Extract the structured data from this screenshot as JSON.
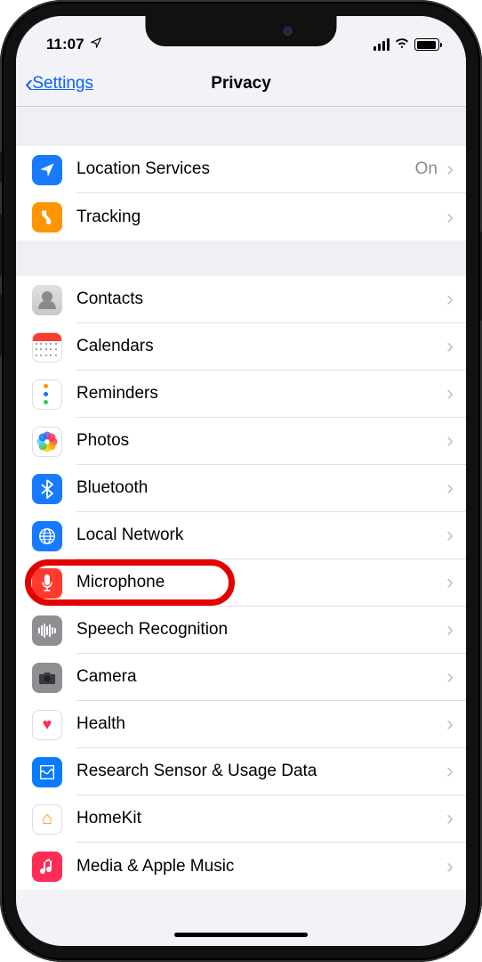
{
  "status": {
    "time": "11:07"
  },
  "nav": {
    "back": "Settings",
    "title": "Privacy"
  },
  "sections": [
    {
      "rows": [
        {
          "key": "location",
          "label": "Location Services",
          "value": "On",
          "iconClass": "ic-location",
          "iconName": "location-arrow-icon"
        },
        {
          "key": "tracking",
          "label": "Tracking",
          "value": "",
          "iconClass": "ic-tracking",
          "iconName": "tracking-icon"
        }
      ]
    },
    {
      "rows": [
        {
          "key": "contacts",
          "label": "Contacts",
          "value": "",
          "iconClass": "ic-contacts",
          "iconName": "contacts-icon"
        },
        {
          "key": "calendars",
          "label": "Calendars",
          "value": "",
          "iconClass": "ic-calendars",
          "iconName": "calendar-icon"
        },
        {
          "key": "reminders",
          "label": "Reminders",
          "value": "",
          "iconClass": "ic-reminders",
          "iconName": "reminders-icon"
        },
        {
          "key": "photos",
          "label": "Photos",
          "value": "",
          "iconClass": "ic-photos",
          "iconName": "photos-icon"
        },
        {
          "key": "bluetooth",
          "label": "Bluetooth",
          "value": "",
          "iconClass": "ic-bluetooth",
          "iconName": "bluetooth-icon"
        },
        {
          "key": "localnet",
          "label": "Local Network",
          "value": "",
          "iconClass": "ic-localnet",
          "iconName": "globe-icon"
        },
        {
          "key": "microphone",
          "label": "Microphone",
          "value": "",
          "iconClass": "ic-mic",
          "iconName": "microphone-icon",
          "highlighted": true
        },
        {
          "key": "speech",
          "label": "Speech Recognition",
          "value": "",
          "iconClass": "ic-speech",
          "iconName": "waveform-icon"
        },
        {
          "key": "camera",
          "label": "Camera",
          "value": "",
          "iconClass": "ic-camera",
          "iconName": "camera-icon"
        },
        {
          "key": "health",
          "label": "Health",
          "value": "",
          "iconClass": "ic-health",
          "iconName": "heart-icon"
        },
        {
          "key": "research",
          "label": "Research Sensor & Usage Data",
          "value": "",
          "iconClass": "ic-research",
          "iconName": "research-icon"
        },
        {
          "key": "homekit",
          "label": "HomeKit",
          "value": "",
          "iconClass": "ic-homekit",
          "iconName": "home-icon"
        },
        {
          "key": "media",
          "label": "Media & Apple Music",
          "value": "",
          "iconClass": "ic-media",
          "iconName": "music-note-icon"
        }
      ]
    }
  ]
}
